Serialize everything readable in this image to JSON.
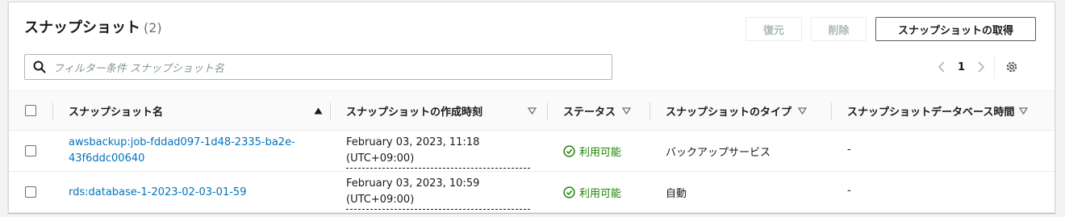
{
  "header": {
    "title": "スナップショット",
    "count": "(2)"
  },
  "actions": {
    "restore": "復元",
    "delete": "削除",
    "take_snapshot": "スナップショットの取得"
  },
  "search": {
    "placeholder": "フィルター条件 スナップショット名"
  },
  "pagination": {
    "current_page": "1"
  },
  "table": {
    "columns": [
      "スナップショット名",
      "スナップショットの作成時刻",
      "ステータス",
      "スナップショットのタイプ",
      "スナップショットデータベース時間"
    ],
    "rows": [
      {
        "name_line1": "awsbackup:job-fddad097-1d48-2335-ba2e-",
        "name_line2": "43f6ddc00640",
        "created_line1": "February 03, 2023, 11:18",
        "created_line2": "(UTC+09:00)",
        "status": "利用可能",
        "type": "バックアップサービス",
        "db_time": "-"
      },
      {
        "name_line1": "rds:database-1-2023-02-03-01-59",
        "name_line2": "",
        "created_line1": "February 03, 2023, 10:59",
        "created_line2": "(UTC+09:00)",
        "status": "利用可能",
        "type": "自動",
        "db_time": "-"
      }
    ]
  },
  "colors": {
    "link": "#0073bb",
    "status_ok": "#1d8102",
    "border": "#eaeded"
  }
}
